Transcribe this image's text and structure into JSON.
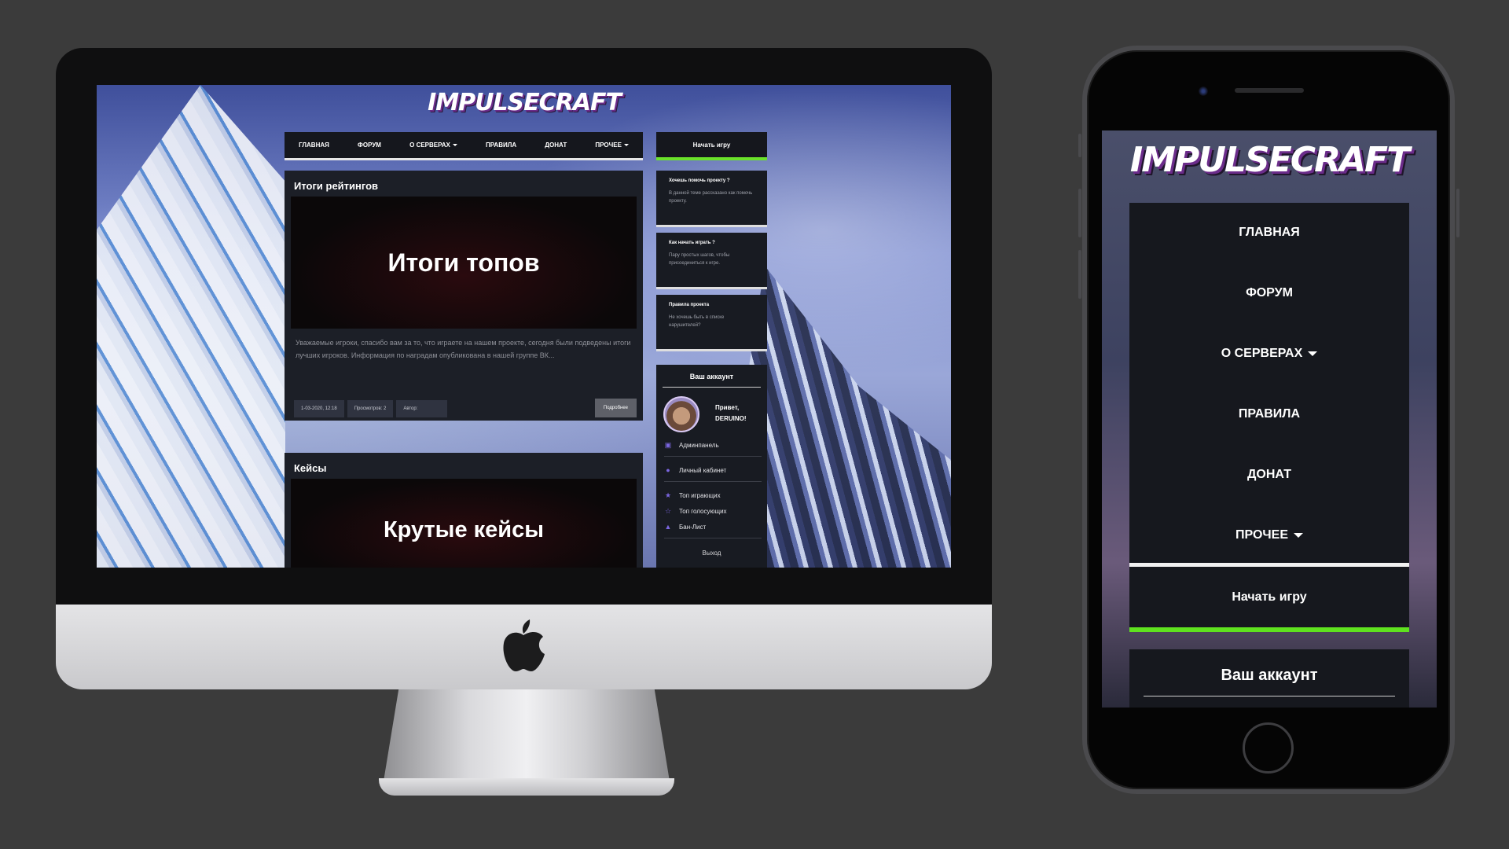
{
  "desktop": {
    "logo": "IMPULSECRAFT",
    "nav": {
      "home": "ГЛАВНАЯ",
      "forum": "ФОРУМ",
      "servers": "О СЕРВЕРАХ",
      "rules": "ПРАВИЛА",
      "donate": "ДОНАТ",
      "other": "ПРОЧЕЕ"
    },
    "start_game": "Начать игру",
    "posts": [
      {
        "title": "Итоги рейтингов",
        "banner": "Итоги топов",
        "text": "Уважаемые игроки, спасибо вам за то, что играете на нашем проекте, сегодня были подведены итоги лучших игроков. Информация по наградам опубликована в нашей группе ВК...",
        "date": "1-03-2020, 12:18",
        "views": "Просмотров: 2",
        "author_label": "Автор:",
        "more": "Подробнее"
      },
      {
        "title": "Кейсы",
        "banner": "Крутые кейсы"
      }
    ],
    "side_cards": [
      {
        "title": "Хочешь помочь проекту ?",
        "text": "В данной теме рассказано как помочь проекту."
      },
      {
        "title": "Как начать играть ?",
        "text": "Пару простых шагов, чтобы присоединиться к игре."
      },
      {
        "title": "Правила проекта",
        "text": "Не хочешь быть в списке нарушителей?"
      }
    ],
    "account": {
      "title": "Ваш аккаунт",
      "hello": "Привет,",
      "username": "DERUINO!",
      "items": [
        "Админпанель",
        "Личный кабинет",
        "Топ играющих",
        "Топ голосующих",
        "Бан-Лист"
      ],
      "logout": "Выход"
    }
  },
  "mobile": {
    "logo": "IMPULSECRAFT",
    "menu": [
      "ГЛАВНАЯ",
      "ФОРУМ",
      "О СЕРВЕРАХ",
      "ПРАВИЛА",
      "ДОНАТ",
      "ПРОЧЕЕ"
    ],
    "start_game": "Начать игру",
    "account_title": "Ваш аккаунт"
  },
  "colors": {
    "accent_green": "#6ae22a",
    "panel_dark": "#16181e",
    "icon_purple": "#7b66e0"
  }
}
